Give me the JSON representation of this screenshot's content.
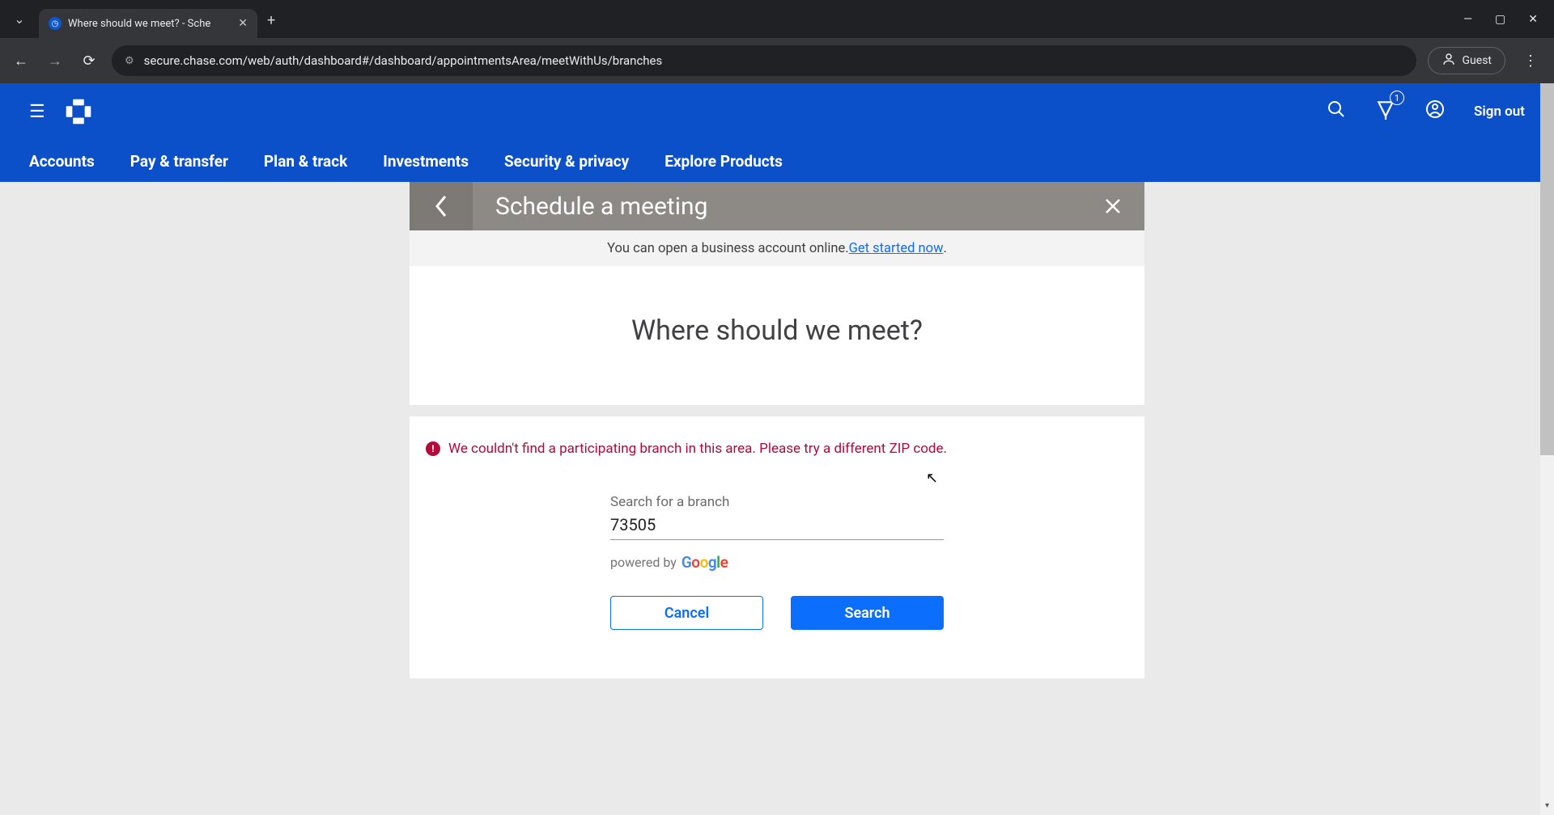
{
  "browser": {
    "tab_title": "Where should we meet? - Sche",
    "url": "secure.chase.com/web/auth/dashboard#/dashboard/appointmentsArea/meetWithUs/branches",
    "guest_label": "Guest"
  },
  "header": {
    "notification_count": "1",
    "signout_label": "Sign out"
  },
  "nav": {
    "items": [
      "Accounts",
      "Pay & transfer",
      "Plan & track",
      "Investments",
      "Security & privacy",
      "Explore Products"
    ]
  },
  "modal": {
    "title": "Schedule a meeting",
    "banner_text": "You can open a business account online. ",
    "banner_link": "Get started now",
    "heading": "Where should we meet?",
    "error_text": "We couldn't find a participating branch in this area. Please try a different ZIP code.",
    "field_label": "Search for a branch",
    "field_value": "73505",
    "powered_prefix": "powered by ",
    "cancel_label": "Cancel",
    "search_label": "Search"
  }
}
